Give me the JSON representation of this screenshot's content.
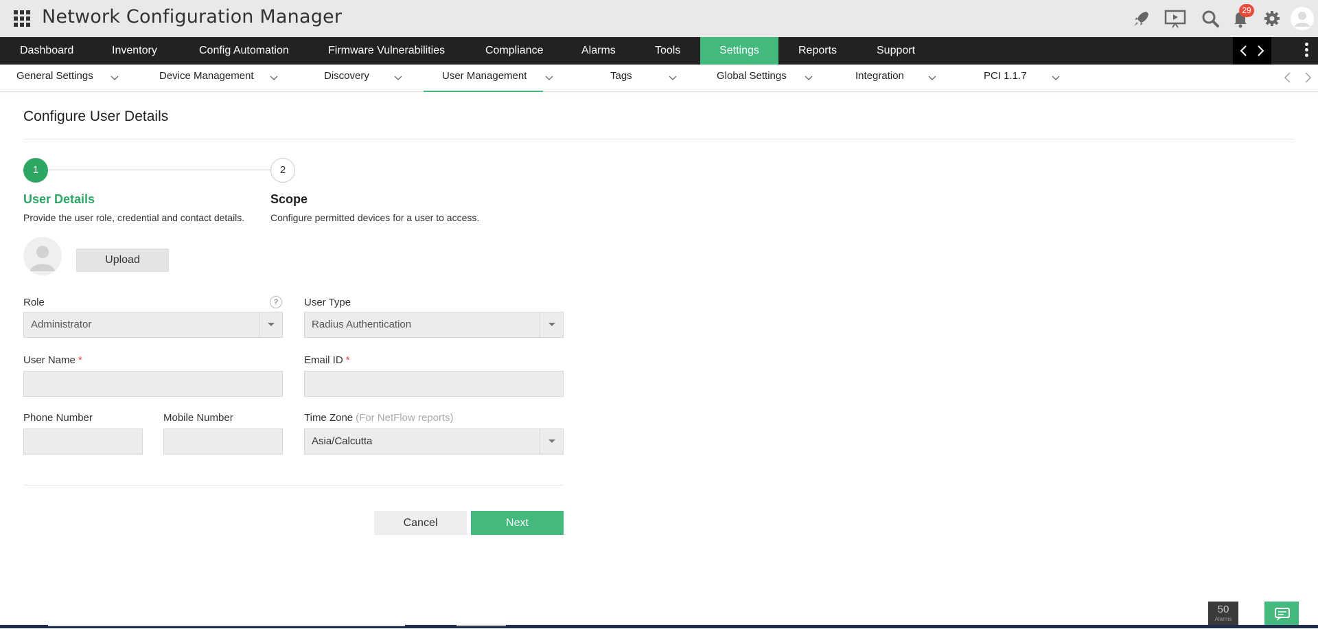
{
  "header": {
    "app_title": "Network Configuration Manager",
    "notification_count": "29"
  },
  "main_nav": {
    "items": [
      {
        "label": "Dashboard"
      },
      {
        "label": "Inventory"
      },
      {
        "label": "Config Automation"
      },
      {
        "label": "Firmware Vulnerabilities"
      },
      {
        "label": "Compliance"
      },
      {
        "label": "Alarms"
      },
      {
        "label": "Tools"
      },
      {
        "label": "Settings",
        "active": true
      },
      {
        "label": "Reports"
      },
      {
        "label": "Support"
      }
    ]
  },
  "sub_nav": {
    "items": [
      {
        "label": "General Settings"
      },
      {
        "label": "Device Management"
      },
      {
        "label": "Discovery"
      },
      {
        "label": "User Management",
        "active": true
      },
      {
        "label": "Tags"
      },
      {
        "label": "Global Settings"
      },
      {
        "label": "Integration"
      },
      {
        "label": "PCI 1.1.7"
      }
    ]
  },
  "page": {
    "title": "Configure User Details"
  },
  "wizard": {
    "steps": [
      {
        "number": "1",
        "title": "User Details",
        "description": "Provide the user role, credential and contact details.",
        "state": "active"
      },
      {
        "number": "2",
        "title": "Scope",
        "description": "Configure permitted devices for a user to access.",
        "state": "pending"
      }
    ]
  },
  "form": {
    "upload_label": "Upload",
    "role": {
      "label": "Role",
      "value": "Administrator",
      "help": "?"
    },
    "user_type": {
      "label": "User Type",
      "value": "Radius Authentication"
    },
    "user_name": {
      "label": "User Name",
      "required_mark": "*",
      "value": ""
    },
    "email_id": {
      "label": "Email ID",
      "required_mark": "*",
      "value": ""
    },
    "phone_number": {
      "label": "Phone Number",
      "value": ""
    },
    "mobile_number": {
      "label": "Mobile Number",
      "value": ""
    },
    "time_zone": {
      "label": "Time Zone",
      "hint": "(For NetFlow reports)",
      "value": "Asia/Calcutta"
    },
    "cancel_label": "Cancel",
    "next_label": "Next"
  },
  "footer": {
    "alarm_count": "50",
    "alarm_label": "Alarms"
  },
  "colors": {
    "accent_green": "#43b97d",
    "step_green": "#2ea764",
    "nav_dark": "#222222",
    "header_bg": "#e9e9ea",
    "badge_red": "#e84c3d"
  },
  "icons": [
    "apps-grid-icon",
    "rocket-icon",
    "presentation-icon",
    "search-icon",
    "bell-icon",
    "gear-icon",
    "user-avatar-icon",
    "chevron-left-icon",
    "chevron-right-icon",
    "kebab-menu-icon",
    "chevron-down-icon",
    "chat-icon"
  ]
}
